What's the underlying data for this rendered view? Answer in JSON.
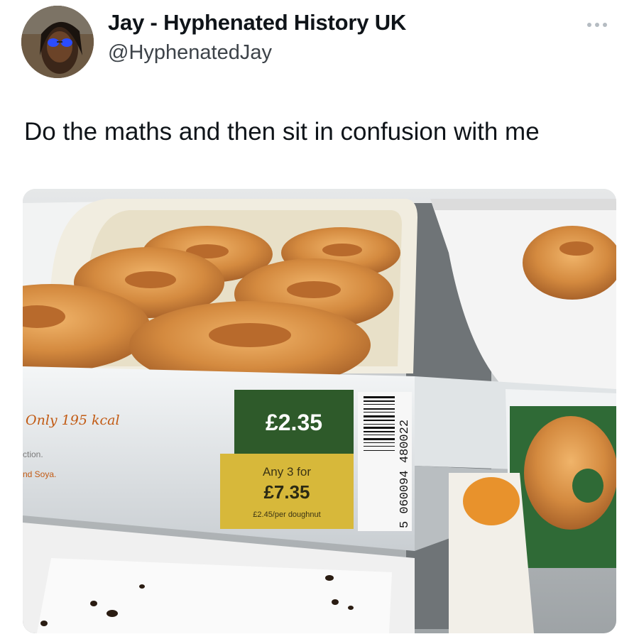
{
  "author": {
    "display_name": "Jay - Hyphenated History UK",
    "handle": "@HyphenatedJay"
  },
  "icons": {
    "avatar": "profile-photo",
    "more": "more-options-icon"
  },
  "tweet": {
    "text": "Do the maths and then sit in confusion with me"
  },
  "photo": {
    "shelf_label": {
      "left_text": "Only 195 kcal",
      "fragment_1": "ction.",
      "fragment_2": "nd Soya.",
      "price": "£2.35",
      "offer_line": "Any 3 for",
      "offer_price": "£7.35",
      "unit_price": "£2.45/per doughnut",
      "barcode_number": "5 060094 480022"
    },
    "colors": {
      "label_green": "#2e5a2a",
      "label_yellow": "#d7b83a",
      "doughnut": "#d9974a"
    }
  }
}
